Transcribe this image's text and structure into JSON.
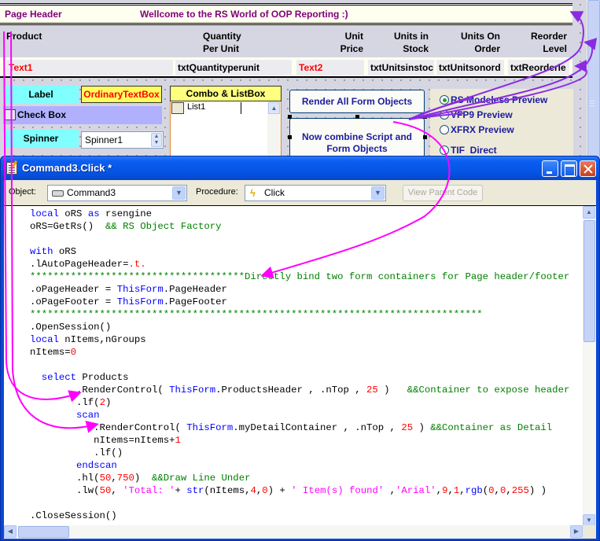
{
  "form": {
    "page_header": {
      "label": "Page Header",
      "welcome_text": "Wellcome to the RS World of OOP Reporting :)"
    },
    "column_headers": [
      {
        "text": "Product"
      },
      {
        "text": "Quantity\nPer Unit"
      },
      {
        "text": "Unit\nPrice"
      },
      {
        "text": "Units in\nStock"
      },
      {
        "text": "Units On\nOrder"
      },
      {
        "text": "Reorder\nLevel"
      }
    ],
    "detail_fields": [
      {
        "text": "Text1"
      },
      {
        "text": "txtQuantityperunit"
      },
      {
        "text": "Text2"
      },
      {
        "text": "txtUnitsinstoc"
      },
      {
        "text": "txtUnitsonord"
      },
      {
        "text": "txtReorderle"
      }
    ],
    "controls": {
      "label": "Label",
      "ordinary_textbox": "OrdinaryTextBox",
      "check_box": "Check Box",
      "spinner_label": "Spinner",
      "spinner_value": "Spinner1",
      "combo_header": "Combo & ListBox",
      "list_item": "List1"
    },
    "buttons": {
      "render_all": "Render All Form Objects",
      "combine": "Now combine Script and Form Objects"
    },
    "preview_options": [
      {
        "label": "RS Modeless Preview",
        "selected": true
      },
      {
        "label": "VFP9 Preview",
        "selected": false
      },
      {
        "label": "XFRX Preview",
        "selected": false
      },
      {
        "label": "TIF  Direct",
        "selected": false
      }
    ]
  },
  "code_window": {
    "title": "Command3.Click *",
    "object_label": "Object:",
    "object_value": "Command3",
    "procedure_label": "Procedure:",
    "procedure_value": "Click",
    "view_parent_code": "View Parent Code",
    "code_lines": [
      [
        {
          "t": "local",
          "c": "kw"
        },
        {
          "t": " oRS "
        },
        {
          "t": "as",
          "c": "kw"
        },
        {
          "t": " rsengine"
        }
      ],
      [
        {
          "t": "oRS=GetRs()  "
        },
        {
          "t": "&& RS Object Factory",
          "c": "cm"
        }
      ],
      [],
      [
        {
          "t": "with",
          "c": "kw"
        },
        {
          "t": " oRS"
        }
      ],
      [
        {
          "t": ".lAutoPageHeader="
        },
        {
          "t": ".t.",
          "c": "nm"
        }
      ],
      [
        {
          "t": "*************************************Directly bind two form containers for Page header/footer",
          "c": "cm"
        }
      ],
      [
        {
          "t": ".oPageHeader = "
        },
        {
          "t": "ThisForm",
          "c": "tf"
        },
        {
          "t": ".PageHeader"
        }
      ],
      [
        {
          "t": ".oPageFooter = "
        },
        {
          "t": "ThisForm",
          "c": "tf"
        },
        {
          "t": ".PageFooter"
        }
      ],
      [
        {
          "t": "******************************************************************************",
          "c": "cm"
        }
      ],
      [
        {
          "t": ".OpenSession()"
        }
      ],
      [
        {
          "t": "local",
          "c": "kw"
        },
        {
          "t": " nItems,nGroups"
        }
      ],
      [
        {
          "t": "nItems="
        },
        {
          "t": "0",
          "c": "nm"
        }
      ],
      [],
      [
        {
          "t": "  "
        },
        {
          "t": "select",
          "c": "kw"
        },
        {
          "t": " Products"
        }
      ],
      [
        {
          "t": "        .RenderControl( "
        },
        {
          "t": "ThisForm",
          "c": "tf"
        },
        {
          "t": ".ProductsHeader , .nTop , "
        },
        {
          "t": "25",
          "c": "nm"
        },
        {
          "t": " )   "
        },
        {
          "t": "&&Container to expose header",
          "c": "cm"
        }
      ],
      [
        {
          "t": "        .lf("
        },
        {
          "t": "2",
          "c": "nm"
        },
        {
          "t": ")"
        }
      ],
      [
        {
          "t": "        "
        },
        {
          "t": "scan",
          "c": "kw"
        }
      ],
      [
        {
          "t": "           .RenderControl( "
        },
        {
          "t": "ThisForm",
          "c": "tf"
        },
        {
          "t": ".myDetailContainer , .nTop , "
        },
        {
          "t": "25",
          "c": "nm"
        },
        {
          "t": " ) "
        },
        {
          "t": "&&Container as Detail",
          "c": "cm"
        }
      ],
      [
        {
          "t": "           nItems=nItems+"
        },
        {
          "t": "1",
          "c": "nm"
        }
      ],
      [
        {
          "t": "           .lf()"
        }
      ],
      [
        {
          "t": "        "
        },
        {
          "t": "endscan",
          "c": "kw"
        }
      ],
      [
        {
          "t": "        .hl("
        },
        {
          "t": "50",
          "c": "nm"
        },
        {
          "t": ","
        },
        {
          "t": "750",
          "c": "nm"
        },
        {
          "t": ")  "
        },
        {
          "t": "&&Draw Line Under",
          "c": "cm"
        }
      ],
      [
        {
          "t": "        .lw("
        },
        {
          "t": "50",
          "c": "nm"
        },
        {
          "t": ", "
        },
        {
          "t": "'Total: '",
          "c": "st"
        },
        {
          "t": "+ "
        },
        {
          "t": "str",
          "c": "kw"
        },
        {
          "t": "(nItems,"
        },
        {
          "t": "4",
          "c": "nm"
        },
        {
          "t": ","
        },
        {
          "t": "0",
          "c": "nm"
        },
        {
          "t": ") + "
        },
        {
          "t": "' Item(s) found'",
          "c": "st"
        },
        {
          "t": " ,"
        },
        {
          "t": "'Arial'",
          "c": "st"
        },
        {
          "t": ","
        },
        {
          "t": "9",
          "c": "nm"
        },
        {
          "t": ","
        },
        {
          "t": "1",
          "c": "nm"
        },
        {
          "t": ","
        },
        {
          "t": "rgb",
          "c": "kw"
        },
        {
          "t": "("
        },
        {
          "t": "0",
          "c": "nm"
        },
        {
          "t": ","
        },
        {
          "t": "0",
          "c": "nm"
        },
        {
          "t": ","
        },
        {
          "t": "255",
          "c": "nm"
        },
        {
          "t": ") )"
        }
      ],
      [],
      [
        {
          "t": ".CloseSession()"
        }
      ]
    ]
  },
  "colors": {
    "annotation_magenta": "#ff00ff",
    "annotation_purple": "#8a2be2",
    "header_text": "#800080",
    "field_red": "#ff0000"
  }
}
